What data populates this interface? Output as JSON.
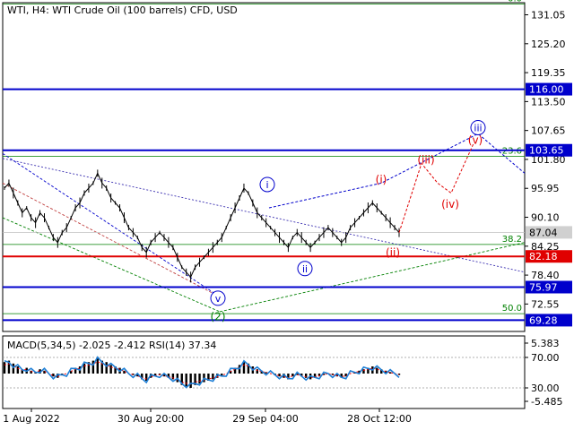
{
  "header": {
    "title": "WTI, H4:  WTI Crude Oil (100 barrels) CFD, USD"
  },
  "indicator": {
    "label": "MACD(5,34,5) -2.025 -2.412 RSI(14) 37.34"
  },
  "colors": {
    "price": "#000000",
    "blue_level": "#0000cc",
    "red_level": "#e00000",
    "fib_green": "#008000",
    "macd_hist": "#000000",
    "rsi_line": "#1e7fd6",
    "signal_line": "#ff0000",
    "current_price_bg": "#d0d0d0"
  },
  "chart_data": {
    "type": "line",
    "main_axis": {
      "ylim": [
        67.0,
        133.5
      ],
      "ticks": [
        "131.05",
        "125.20",
        "119.35",
        "113.50",
        "107.65",
        "101.80",
        "95.95",
        "90.10",
        "84.25",
        "78.40",
        "72.55"
      ],
      "tick_values": [
        131.05,
        125.2,
        119.35,
        113.5,
        107.65,
        101.8,
        95.95,
        90.1,
        84.25,
        78.4,
        72.55
      ]
    },
    "x_ticks": [
      "1 Aug 2022",
      "30 Aug 20:00",
      "29 Sep 04:00",
      "28 Oct 12:00"
    ],
    "level_lines": [
      {
        "value": 116.0,
        "label": "116.00",
        "color": "#0000cc"
      },
      {
        "value": 103.65,
        "label": "103.65",
        "color": "#0000cc"
      },
      {
        "value": 82.18,
        "label": "82.18",
        "color": "#e00000"
      },
      {
        "value": 75.97,
        "label": "75.97",
        "color": "#0000cc"
      },
      {
        "value": 69.28,
        "label": "69.28",
        "color": "#0000cc"
      }
    ],
    "current_price": {
      "value": 87.04,
      "label": "87.04"
    },
    "fib_levels": [
      {
        "value": 133.2,
        "label": "0.0"
      },
      {
        "value": 102.4,
        "label": "23.6"
      },
      {
        "value": 84.6,
        "label": "38.2"
      },
      {
        "value": 70.6,
        "label": "50.0"
      }
    ],
    "wave_labels": [
      {
        "text": "v",
        "style": "blue-circle"
      },
      {
        "text": "(2)",
        "style": "green"
      },
      {
        "text": "i",
        "style": "blue-circle"
      },
      {
        "text": "ii",
        "style": "blue-circle"
      },
      {
        "text": "iii",
        "style": "blue-circle"
      },
      {
        "text": "(i)",
        "style": "red"
      },
      {
        "text": "(ii)",
        "style": "red"
      },
      {
        "text": "(iii)",
        "style": "red"
      },
      {
        "text": "(iv)",
        "style": "red"
      },
      {
        "text": "(v)",
        "style": "red"
      }
    ],
    "price_series": [
      96,
      97,
      95,
      93,
      91,
      92,
      90,
      89,
      91,
      90,
      88,
      86,
      85,
      87,
      88,
      90,
      92,
      93,
      95,
      96,
      97,
      99,
      97,
      96,
      94,
      93,
      92,
      90,
      88,
      87,
      86,
      84,
      83,
      85,
      86,
      87,
      86,
      85,
      84,
      82,
      80,
      79,
      78,
      80,
      81,
      82,
      83,
      84,
      85,
      86,
      88,
      90,
      92,
      94,
      96,
      95,
      93,
      91,
      90,
      89,
      88,
      87,
      86,
      85,
      84,
      86,
      87,
      86,
      85,
      84,
      85,
      86,
      87,
      88,
      87,
      86,
      85,
      86,
      88,
      89,
      90,
      91,
      92,
      93,
      92,
      91,
      90,
      89,
      88,
      87
    ],
    "indicator_axis": {
      "ticks": [
        "5.383",
        "70.00",
        "30.00",
        "-5.485"
      ],
      "tick_values": [
        5.383,
        70.0,
        30.0,
        -5.485
      ]
    }
  }
}
